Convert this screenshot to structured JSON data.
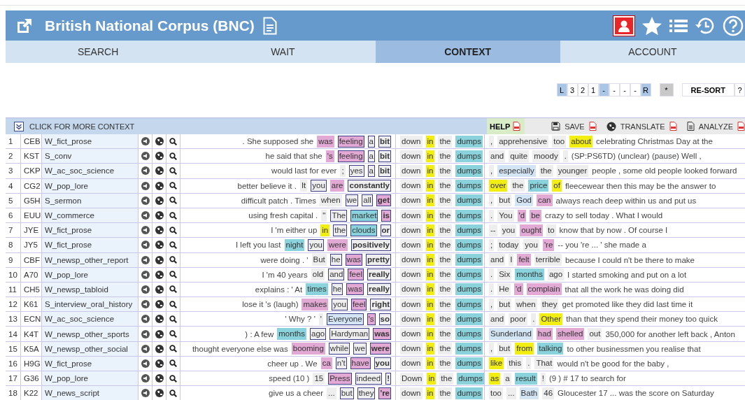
{
  "header": {
    "title": "British National Corpus (BNC)"
  },
  "tabs": [
    {
      "label": "SEARCH",
      "selected": false
    },
    {
      "label": "WAIT",
      "selected": false
    },
    {
      "label": "CONTEXT",
      "selected": true
    },
    {
      "label": "ACCOUNT",
      "selected": false
    }
  ],
  "sort_bar": {
    "keys": [
      {
        "label": "L",
        "selected": true
      },
      {
        "label": "3",
        "selected": false
      },
      {
        "label": "2",
        "selected": false
      },
      {
        "label": "1",
        "selected": false
      },
      {
        "label": "-",
        "selected": true
      },
      {
        "label": "-",
        "selected": false
      },
      {
        "label": "-",
        "selected": false
      },
      {
        "label": "-",
        "selected": false
      },
      {
        "label": "R",
        "selected": true
      }
    ],
    "star_key": "*",
    "resort": "RE-SORT",
    "help_key": "?"
  },
  "toolbar": {
    "expand": "CLICK FOR MORE CONTEXT",
    "help": "HELP",
    "actions": [
      {
        "kind": "save",
        "label": "SAVE"
      },
      {
        "kind": "translate",
        "label": "TRANSLATE"
      },
      {
        "kind": "analyze",
        "label": "ANALYZE"
      }
    ]
  },
  "rows": [
    {
      "n": "1",
      "code": "CEB",
      "genre": "W_fict_prose",
      "left_text": ". She supposed she",
      "left": [
        {
          "text": "was",
          "color": "#e2a9d4",
          "boxed": false
        },
        {
          "text": "feeling",
          "color": "#e2a9d4",
          "boxed": true
        },
        {
          "text": "a",
          "color": "#eeeeee",
          "boxed": true
        },
        {
          "text": "bit",
          "color": "#eeeeee",
          "boxed": true
        }
      ],
      "node": [
        {
          "text": "down",
          "color": "#eeeeee"
        },
        {
          "text": "in",
          "color": "#f3ee12"
        },
        {
          "text": "the",
          "color": "#eeeeee"
        },
        {
          "text": "dumps",
          "color": "#8bd3dc"
        }
      ],
      "right": [
        {
          "text": ",",
          "color": "#eeeeee"
        },
        {
          "text": "apprehensive",
          "color": "#eeeeee"
        },
        {
          "text": "too",
          "color": "#eeeeee"
        },
        {
          "text": "about",
          "color": "#f3ee12"
        }
      ],
      "right_text": "celebrating Christmas Day at the"
    },
    {
      "n": "2",
      "code": "KST",
      "genre": "S_conv",
      "left_text": "he said that she",
      "left": [
        {
          "text": "'s",
          "color": "#e2a9d4",
          "boxed": false
        },
        {
          "text": "feeling",
          "color": "#e2a9d4",
          "boxed": true
        },
        {
          "text": "a",
          "color": "#eeeeee",
          "boxed": true
        },
        {
          "text": "bit",
          "color": "#eeeeee",
          "boxed": true
        }
      ],
      "node": [
        {
          "text": "down",
          "color": "#eeeeee"
        },
        {
          "text": "in",
          "color": "#f3ee12"
        },
        {
          "text": "the",
          "color": "#eeeeee"
        },
        {
          "text": "dumps",
          "color": "#8bd3dc"
        }
      ],
      "right": [
        {
          "text": "and",
          "color": "#eeeeee"
        },
        {
          "text": "quite",
          "color": "#eeeeee"
        },
        {
          "text": "moody",
          "color": "#eeeeee"
        },
        {
          "text": ".",
          "color": "#eeeeee"
        }
      ],
      "right_text": "(SP:PS6TD) (unclear) (pause) Well ,"
    },
    {
      "n": "3",
      "code": "CKP",
      "genre": "W_ac_soc_science",
      "left_text": "would last for ever",
      "left": [
        {
          "text": ";",
          "color": "#eeeeee",
          "boxed": false
        },
        {
          "text": "yes",
          "color": "#eeeeee",
          "boxed": true
        },
        {
          "text": "a",
          "color": "#eeeeee",
          "boxed": true
        },
        {
          "text": "bit",
          "color": "#eeeeee",
          "boxed": true
        }
      ],
      "node": [
        {
          "text": "down",
          "color": "#eeeeee"
        },
        {
          "text": "in",
          "color": "#f3ee12"
        },
        {
          "text": "the",
          "color": "#eeeeee"
        },
        {
          "text": "dumps",
          "color": "#8bd3dc"
        }
      ],
      "right": [
        {
          "text": ",",
          "color": "#eeeeee"
        },
        {
          "text": "especially",
          "color": "#d3e5f5"
        },
        {
          "text": "the",
          "color": "#eeeeee"
        },
        {
          "text": "younger",
          "color": "#eeeeee"
        }
      ],
      "right_text": "people , some old people looked forward"
    },
    {
      "n": "4",
      "code": "CG2",
      "genre": "W_pop_lore",
      "left_text": "better believe it .",
      "left": [
        {
          "text": "It",
          "color": "#eeeeee",
          "boxed": false
        },
        {
          "text": "you",
          "color": "#eeeeee",
          "boxed": true
        },
        {
          "text": "are",
          "color": "#e2a9d4",
          "boxed": false
        },
        {
          "text": "constantly",
          "color": "#eeeeee",
          "boxed": true
        }
      ],
      "node": [
        {
          "text": "down",
          "color": "#eeeeee"
        },
        {
          "text": "in",
          "color": "#f3ee12"
        },
        {
          "text": "the",
          "color": "#eeeeee"
        },
        {
          "text": "dumps",
          "color": "#8bd3dc"
        }
      ],
      "right": [
        {
          "text": "over",
          "color": "#f3ee12"
        },
        {
          "text": "the",
          "color": "#eeeeee"
        },
        {
          "text": "price",
          "color": "#8bd3dc"
        },
        {
          "text": "of",
          "color": "#f3ee12"
        }
      ],
      "right_text": "fleecewear then this may be the answer to"
    },
    {
      "n": "5",
      "code": "G5H",
      "genre": "S_sermon",
      "left_text": "difficult patch . Times",
      "left": [
        {
          "text": "when",
          "color": "#eeeeee",
          "boxed": false
        },
        {
          "text": "we",
          "color": "#eeeeee",
          "boxed": true
        },
        {
          "text": "all",
          "color": "#eeeeee",
          "boxed": true
        },
        {
          "text": "get",
          "color": "#e2a9d4",
          "boxed": true
        }
      ],
      "node": [
        {
          "text": "down",
          "color": "#eeeeee"
        },
        {
          "text": "in",
          "color": "#f3ee12"
        },
        {
          "text": "the",
          "color": "#eeeeee"
        },
        {
          "text": "dumps",
          "color": "#8bd3dc"
        }
      ],
      "right": [
        {
          "text": ",",
          "color": "#eeeeee"
        },
        {
          "text": "but",
          "color": "#eeeeee"
        },
        {
          "text": "God",
          "color": "#d3e5f5"
        },
        {
          "text": "can",
          "color": "#e2a9d4"
        }
      ],
      "right_text": "always reach deep within us and put us"
    },
    {
      "n": "6",
      "code": "EUU",
      "genre": "W_commerce",
      "left_text": "using fresh capital .",
      "left": [
        {
          "text": "\"",
          "color": "#eeeeee",
          "boxed": false
        },
        {
          "text": "The",
          "color": "#eeeeee",
          "boxed": true
        },
        {
          "text": "market",
          "color": "#8bd3dc",
          "boxed": true
        },
        {
          "text": "is",
          "color": "#e2a9d4",
          "boxed": true
        }
      ],
      "node": [
        {
          "text": "down",
          "color": "#eeeeee"
        },
        {
          "text": "in",
          "color": "#f3ee12"
        },
        {
          "text": "the",
          "color": "#eeeeee"
        },
        {
          "text": "dumps",
          "color": "#8bd3dc"
        }
      ],
      "right": [
        {
          "text": ".",
          "color": "#eeeeee"
        },
        {
          "text": "You",
          "color": "#eeeeee"
        },
        {
          "text": "'d",
          "color": "#e2a9d4"
        },
        {
          "text": "be",
          "color": "#e2a9d4"
        }
      ],
      "right_text": "crazy to sell today . What I would"
    },
    {
      "n": "7",
      "code": "JYE",
      "genre": "W_fict_prose",
      "left_text": "I 'm either up",
      "left": [
        {
          "text": "in",
          "color": "#f3ee12",
          "boxed": false
        },
        {
          "text": "the",
          "color": "#eeeeee",
          "boxed": true
        },
        {
          "text": "clouds",
          "color": "#8bd3dc",
          "boxed": true
        },
        {
          "text": "or",
          "color": "#eeeeee",
          "boxed": true
        }
      ],
      "node": [
        {
          "text": "down",
          "color": "#eeeeee"
        },
        {
          "text": "in",
          "color": "#f3ee12"
        },
        {
          "text": "the",
          "color": "#eeeeee"
        },
        {
          "text": "dumps",
          "color": "#8bd3dc"
        }
      ],
      "right": [
        {
          "text": "--",
          "color": "#eeeeee"
        },
        {
          "text": "you",
          "color": "#eeeeee"
        },
        {
          "text": "ought",
          "color": "#e2a9d4"
        },
        {
          "text": "to",
          "color": "#eeeeee"
        }
      ],
      "right_text": "know that by now . Of course I"
    },
    {
      "n": "8",
      "code": "JY5",
      "genre": "W_fict_prose",
      "left_text": "I left you last",
      "left": [
        {
          "text": "night",
          "color": "#8bd3dc",
          "boxed": false
        },
        {
          "text": "you",
          "color": "#eeeeee",
          "boxed": true
        },
        {
          "text": "were",
          "color": "#e2a9d4",
          "boxed": false
        },
        {
          "text": "positively",
          "color": "#eeeeee",
          "boxed": true
        }
      ],
      "node": [
        {
          "text": "down",
          "color": "#eeeeee"
        },
        {
          "text": "in",
          "color": "#f3ee12"
        },
        {
          "text": "the",
          "color": "#eeeeee"
        },
        {
          "text": "dumps",
          "color": "#8bd3dc"
        }
      ],
      "right": [
        {
          "text": ";",
          "color": "#eeeeee"
        },
        {
          "text": "today",
          "color": "#eeeeee"
        },
        {
          "text": "you",
          "color": "#eeeeee"
        },
        {
          "text": "'re",
          "color": "#e2a9d4"
        }
      ],
      "right_text": "-- you 're ... ' she made a"
    },
    {
      "n": "9",
      "code": "CBF",
      "genre": "W_newsp_other_report",
      "left_text": "were doing . '",
      "left": [
        {
          "text": "But",
          "color": "#eeeeee",
          "boxed": false
        },
        {
          "text": "he",
          "color": "#eeeeee",
          "boxed": true
        },
        {
          "text": "was",
          "color": "#e2a9d4",
          "boxed": true
        },
        {
          "text": "pretty",
          "color": "#eeeeee",
          "boxed": true
        }
      ],
      "node": [
        {
          "text": "down",
          "color": "#eeeeee"
        },
        {
          "text": "in",
          "color": "#f3ee12"
        },
        {
          "text": "the",
          "color": "#eeeeee"
        },
        {
          "text": "dumps",
          "color": "#8bd3dc"
        }
      ],
      "right": [
        {
          "text": "and",
          "color": "#eeeeee"
        },
        {
          "text": "I",
          "color": "#eeeeee"
        },
        {
          "text": "felt",
          "color": "#e2a9d4"
        },
        {
          "text": "terrible",
          "color": "#eeeeee"
        }
      ],
      "right_text": "because I could n't be there to make"
    },
    {
      "n": "10",
      "code": "A70",
      "genre": "W_pop_lore",
      "left_text": "I 'm 40 years",
      "left": [
        {
          "text": "old",
          "color": "#eeeeee",
          "boxed": false
        },
        {
          "text": "and",
          "color": "#eeeeee",
          "boxed": true
        },
        {
          "text": "feel",
          "color": "#e2a9d4",
          "boxed": true
        },
        {
          "text": "really",
          "color": "#eeeeee",
          "boxed": true
        }
      ],
      "node": [
        {
          "text": "down",
          "color": "#eeeeee"
        },
        {
          "text": "in",
          "color": "#f3ee12"
        },
        {
          "text": "the",
          "color": "#eeeeee"
        },
        {
          "text": "dumps",
          "color": "#8bd3dc"
        }
      ],
      "right": [
        {
          "text": ".",
          "color": "#eeeeee"
        },
        {
          "text": "Six",
          "color": "#eeeeee"
        },
        {
          "text": "months",
          "color": "#8bd3dc"
        },
        {
          "text": "ago",
          "color": "#eeeeee"
        }
      ],
      "right_text": "I started smoking and put on a lot"
    },
    {
      "n": "11",
      "code": "CH5",
      "genre": "W_newsp_tabloid",
      "left_text": "explains : ' At",
      "left": [
        {
          "text": "times",
          "color": "#8bd3dc",
          "boxed": false
        },
        {
          "text": "he",
          "color": "#eeeeee",
          "boxed": true
        },
        {
          "text": "was",
          "color": "#e2a9d4",
          "boxed": true
        },
        {
          "text": "really",
          "color": "#eeeeee",
          "boxed": true
        }
      ],
      "node": [
        {
          "text": "down",
          "color": "#eeeeee"
        },
        {
          "text": "in",
          "color": "#f3ee12"
        },
        {
          "text": "the",
          "color": "#eeeeee"
        },
        {
          "text": "dumps",
          "color": "#8bd3dc"
        }
      ],
      "right": [
        {
          "text": ".",
          "color": "#eeeeee"
        },
        {
          "text": "He",
          "color": "#eeeeee"
        },
        {
          "text": "'d",
          "color": "#e2a9d4"
        },
        {
          "text": "complain",
          "color": "#e2a9d4"
        }
      ],
      "right_text": "that all the work he was doing did"
    },
    {
      "n": "12",
      "code": "K61",
      "genre": "S_interview_oral_history",
      "left_text": "lose it 's (laugh)",
      "left": [
        {
          "text": "makes",
          "color": "#e2a9d4",
          "boxed": false
        },
        {
          "text": "you",
          "color": "#eeeeee",
          "boxed": true
        },
        {
          "text": "feel",
          "color": "#e2a9d4",
          "boxed": true
        },
        {
          "text": "right",
          "color": "#eeeeee",
          "boxed": true
        }
      ],
      "node": [
        {
          "text": "down",
          "color": "#eeeeee"
        },
        {
          "text": "in",
          "color": "#f3ee12"
        },
        {
          "text": "the",
          "color": "#eeeeee"
        },
        {
          "text": "dumps",
          "color": "#8bd3dc"
        }
      ],
      "right": [
        {
          "text": ",",
          "color": "#eeeeee"
        },
        {
          "text": "but",
          "color": "#eeeeee"
        },
        {
          "text": "when",
          "color": "#eeeeee"
        },
        {
          "text": "they",
          "color": "#eeeeee"
        }
      ],
      "right_text": "get promoted like they did last time it"
    },
    {
      "n": "13",
      "code": "ECN",
      "genre": "W_ac_soc_science",
      "left_text": "' Why ? '",
      "left": [
        {
          "text": "'",
          "color": "#eeeeee",
          "boxed": false
        },
        {
          "text": "Everyone",
          "color": "#d3e5f5",
          "boxed": true
        },
        {
          "text": "'s",
          "color": "#e2a9d4",
          "boxed": true
        },
        {
          "text": "so",
          "color": "#eeeeee",
          "boxed": true
        }
      ],
      "node": [
        {
          "text": "down",
          "color": "#eeeeee"
        },
        {
          "text": "in",
          "color": "#f3ee12"
        },
        {
          "text": "the",
          "color": "#eeeeee"
        },
        {
          "text": "dumps",
          "color": "#8bd3dc"
        }
      ],
      "right": [
        {
          "text": "and",
          "color": "#eeeeee"
        },
        {
          "text": "poor",
          "color": "#eeeeee"
        },
        {
          "text": ".",
          "color": "#eeeeee"
        },
        {
          "text": "Other",
          "color": "#f3ee12"
        }
      ],
      "right_text": "than that they spend their money too quick"
    },
    {
      "n": "14",
      "code": "K4T",
      "genre": "W_newsp_other_sports",
      "left_text": ") : A few",
      "left": [
        {
          "text": "months",
          "color": "#8bd3dc",
          "boxed": false
        },
        {
          "text": "ago",
          "color": "#eeeeee",
          "boxed": true
        },
        {
          "text": "Hardyman",
          "color": "#eeeeee",
          "boxed": true
        },
        {
          "text": "was",
          "color": "#e2a9d4",
          "boxed": true
        }
      ],
      "node": [
        {
          "text": "down",
          "color": "#eeeeee"
        },
        {
          "text": "in",
          "color": "#f3ee12"
        },
        {
          "text": "the",
          "color": "#eeeeee"
        },
        {
          "text": "dumps",
          "color": "#8bd3dc"
        }
      ],
      "right": [
        {
          "text": "Sunderland",
          "color": "#d3e5f5"
        },
        {
          "text": "had",
          "color": "#e2a9d4"
        },
        {
          "text": "shelled",
          "color": "#e2a9d4"
        },
        {
          "text": "out",
          "color": "#eeeeee"
        }
      ],
      "right_text": "350,000 for another left back , Anton"
    },
    {
      "n": "15",
      "code": "K5A",
      "genre": "W_newsp_other_social",
      "left_text": "thought everyone else was",
      "left": [
        {
          "text": "booming",
          "color": "#e2a9d4",
          "boxed": false
        },
        {
          "text": "while",
          "color": "#eeeeee",
          "boxed": true
        },
        {
          "text": "we",
          "color": "#eeeeee",
          "boxed": true
        },
        {
          "text": "were",
          "color": "#e2a9d4",
          "boxed": true
        }
      ],
      "node": [
        {
          "text": "down",
          "color": "#eeeeee"
        },
        {
          "text": "in",
          "color": "#f3ee12"
        },
        {
          "text": "the",
          "color": "#eeeeee"
        },
        {
          "text": "dumps",
          "color": "#8bd3dc"
        }
      ],
      "right": [
        {
          "text": ",",
          "color": "#eeeeee"
        },
        {
          "text": "but",
          "color": "#eeeeee"
        },
        {
          "text": "from",
          "color": "#f3ee12"
        },
        {
          "text": "talking",
          "color": "#8bd3dc"
        }
      ],
      "right_text": "to other businessmen you realise that"
    },
    {
      "n": "16",
      "code": "H9G",
      "genre": "W_fict_prose",
      "left_text": "cheer up . We",
      "left": [
        {
          "text": "ca",
          "color": "#e2a9d4",
          "boxed": false
        },
        {
          "text": "n't",
          "color": "#eeeeee",
          "boxed": true
        },
        {
          "text": "have",
          "color": "#e2a9d4",
          "boxed": true
        },
        {
          "text": "you",
          "color": "#eeeeee",
          "boxed": true
        }
      ],
      "node": [
        {
          "text": "down",
          "color": "#eeeeee"
        },
        {
          "text": "in",
          "color": "#f3ee12"
        },
        {
          "text": "the",
          "color": "#eeeeee"
        },
        {
          "text": "dumps",
          "color": "#8bd3dc"
        }
      ],
      "right": [
        {
          "text": "like",
          "color": "#f3ee12"
        },
        {
          "text": "this",
          "color": "#eeeeee"
        },
        {
          "text": ".",
          "color": "#eeeeee"
        },
        {
          "text": "That",
          "color": "#eeeeee"
        }
      ],
      "right_text": "would n't be good for the baby ,"
    },
    {
      "n": "17",
      "code": "G36",
      "genre": "W_pop_lore",
      "left_text": "speed (10 )",
      "left": [
        {
          "text": "15",
          "color": "#eeeeee",
          "boxed": false
        },
        {
          "text": "Press",
          "color": "#e2a9d4",
          "boxed": true
        },
        {
          "text": "indeed",
          "color": "#eeeeee",
          "boxed": true
        },
        {
          "text": "!",
          "color": "#eeeeee",
          "boxed": true
        }
      ],
      "node": [
        {
          "text": "Down",
          "color": "#eeeeee"
        },
        {
          "text": "in",
          "color": "#f3ee12"
        },
        {
          "text": "the",
          "color": "#eeeeee"
        },
        {
          "text": "dumps",
          "color": "#8bd3dc"
        }
      ],
      "right": [
        {
          "text": "as",
          "color": "#f3ee12"
        },
        {
          "text": "a",
          "color": "#eeeeee"
        },
        {
          "text": "result",
          "color": "#8bd3dc"
        },
        {
          "text": "!",
          "color": "#eeeeee"
        }
      ],
      "right_text": "(9 ) # 17 to search for"
    },
    {
      "n": "18",
      "code": "K22",
      "genre": "W_news_script",
      "left_text": "give us a cheer",
      "left": [
        {
          "text": "...",
          "color": "#eeeeee",
          "boxed": false
        },
        {
          "text": "but",
          "color": "#eeeeee",
          "boxed": true
        },
        {
          "text": "they",
          "color": "#eeeeee",
          "boxed": true
        },
        {
          "text": "'re",
          "color": "#e2a9d4",
          "boxed": true
        }
      ],
      "node": [
        {
          "text": "down",
          "color": "#eeeeee"
        },
        {
          "text": "in",
          "color": "#f3ee12"
        },
        {
          "text": "the",
          "color": "#eeeeee"
        },
        {
          "text": "dumps",
          "color": "#8bd3dc"
        }
      ],
      "right": [
        {
          "text": "too",
          "color": "#eeeeee"
        },
        {
          "text": "...",
          "color": "#eeeeee"
        },
        {
          "text": "Bath",
          "color": "#d3e5f5"
        },
        {
          "text": "46",
          "color": "#eeeeee"
        }
      ],
      "right_text": "Gloucester 17 ... was the score on Saturday"
    }
  ]
}
